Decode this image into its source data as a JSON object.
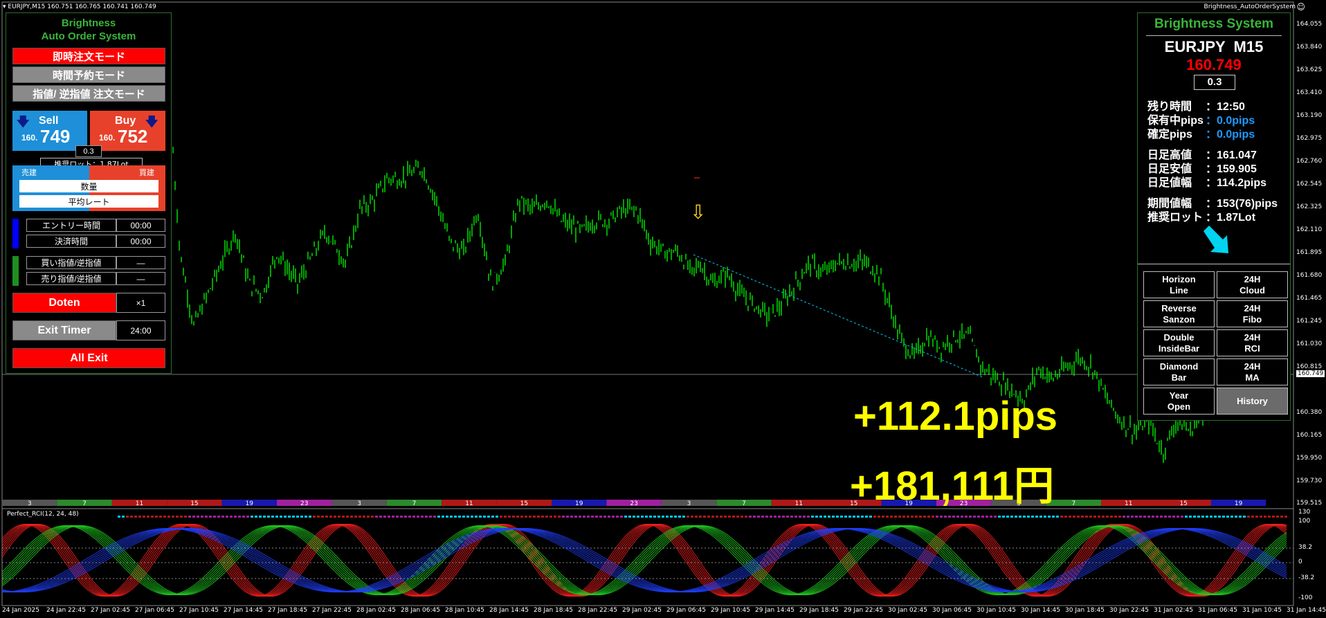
{
  "window": {
    "title": "EURJPY,M15  160.751 160.765 160.741 160.749",
    "ea_name": "Brightness_AutoOrderSystem"
  },
  "left_panel": {
    "title_line1": "Brightness",
    "title_line2": "Auto Order System",
    "mode_instant": "即時注文モード",
    "mode_time": "時間予約モード",
    "mode_limit": "指値/ 逆指値 注文モード",
    "sell_label": "Sell",
    "sell_price_small": "160.",
    "sell_price_big": "749",
    "buy_label": "Buy",
    "buy_price_small": "160.",
    "buy_price_big": "752",
    "lot_value": "0.3",
    "recommended_lot": "推奨ロット：1.87Lot",
    "sell_tag": "売建",
    "buy_tag": "買建",
    "quantity_label": "数量",
    "avg_rate_label": "平均レート",
    "entry_time_label": "エントリー時間",
    "entry_time_value": "00:00",
    "exit_time_label": "決済時間",
    "exit_time_value": "00:00",
    "buy_limit_label": "買い指値/逆指値",
    "buy_limit_value": "—",
    "sell_limit_label": "売り指値/逆指値",
    "sell_limit_value": "—",
    "doten_label": "Doten",
    "doten_mult": "×1",
    "exit_timer_label": "Exit Timer",
    "exit_timer_value": "24:00",
    "all_exit_label": "All Exit"
  },
  "right_panel": {
    "title": "Brightness System",
    "symbol": "EURJPY  M15",
    "price": "160.749",
    "lot": "0.3",
    "remaining_label": "残り時間",
    "remaining_value": "：12:50",
    "holding_label": "保有中pips",
    "holding_value": "：0.0pips",
    "confirmed_label": "確定pips",
    "confirmed_value": "：0.0pips",
    "daily_high_label": "日足高値",
    "daily_high_value": "：161.047",
    "daily_low_label": "日足安値",
    "daily_low_value": "：159.905",
    "daily_range_label": "日足値幅",
    "daily_range_value": "：114.2pips",
    "period_range_label": "期間値幅",
    "period_range_value": "：153(76)pips",
    "rec_lot_label": "推奨ロット",
    "rec_lot_value": "：1.87Lot",
    "buttons": [
      {
        "l1": "Horizon",
        "l2": "Line"
      },
      {
        "l1": "24H",
        "l2": "Cloud"
      },
      {
        "l1": "Reverse",
        "l2": "Sanzon"
      },
      {
        "l1": "24H",
        "l2": "Fibo"
      },
      {
        "l1": "Double",
        "l2": "InsideBar"
      },
      {
        "l1": "24H",
        "l2": "RCI"
      },
      {
        "l1": "Diamond",
        "l2": "Bar"
      },
      {
        "l1": "24H",
        "l2": "MA"
      },
      {
        "l1": "Year",
        "l2": "Open"
      },
      {
        "l1": "History",
        "l2": ""
      }
    ]
  },
  "overlay": {
    "pips": "+112.1pips",
    "yen": "+181,111円"
  },
  "price_axis": {
    "labels": [
      "164.055",
      "163.840",
      "163.625",
      "163.410",
      "163.190",
      "162.975",
      "162.760",
      "162.545",
      "162.325",
      "162.110",
      "161.895",
      "161.680",
      "161.465",
      "161.245",
      "161.030",
      "160.815",
      "160.749",
      "160.380",
      "160.165",
      "159.950",
      "159.730",
      "159.515"
    ],
    "current": "160.749"
  },
  "indicator": {
    "name": "Perfect_RCI(12, 24, 48)",
    "levels": [
      "130",
      "100",
      "38.2",
      "0",
      "-38.2",
      "-100"
    ]
  },
  "session_bar": {
    "labels": [
      "3",
      "7",
      "11",
      "15",
      "19",
      "23",
      "3",
      "7",
      "11",
      "15",
      "19",
      "23",
      "3",
      "7",
      "11",
      "15",
      "19",
      "23",
      "3",
      "7",
      "11",
      "15",
      "19"
    ]
  },
  "time_axis": {
    "labels": [
      "24 Jan 2025",
      "24 Jan 22:45",
      "27 Jan 02:45",
      "27 Jan 06:45",
      "27 Jan 10:45",
      "27 Jan 14:45",
      "27 Jan 18:45",
      "27 Jan 22:45",
      "28 Jan 02:45",
      "28 Jan 06:45",
      "28 Jan 10:45",
      "28 Jan 14:45",
      "28 Jan 18:45",
      "28 Jan 22:45",
      "29 Jan 02:45",
      "29 Jan 06:45",
      "29 Jan 10:45",
      "29 Jan 14:45",
      "29 Jan 18:45",
      "29 Jan 22:45",
      "30 Jan 02:45",
      "30 Jan 06:45",
      "30 Jan 10:45",
      "30 Jan 14:45",
      "30 Jan 18:45",
      "30 Jan 22:45",
      "31 Jan 02:45",
      "31 Jan 06:45",
      "31 Jan 10:45",
      "31 Jan 14:45"
    ]
  },
  "colors": {
    "candle": "#00ff00",
    "panel_green": "#39b53a",
    "price_red": "#ff0000",
    "pips_blue": "#1e9bff",
    "overlay_yellow": "#ffff00",
    "arrow_cyan": "#00d4f0"
  }
}
